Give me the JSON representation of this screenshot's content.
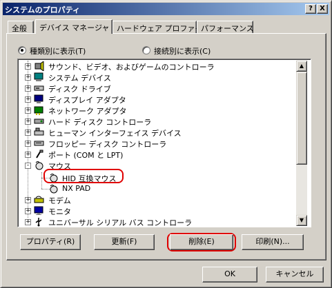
{
  "window": {
    "title": "システムのプロパティ",
    "help_button": "?",
    "close_button": "X"
  },
  "tabs": [
    {
      "label": "全般"
    },
    {
      "label": "デバイス マネージャ"
    },
    {
      "label": "ハードウェア プロファイル"
    },
    {
      "label": "パフォーマンス"
    }
  ],
  "view_options": {
    "by_type": "種類別に表示(T)",
    "by_connection": "接続別に表示(C)",
    "selected": "by_type"
  },
  "tree": [
    {
      "label": "サウンド、ビデオ、およびゲームのコントローラ",
      "icon": "sound-icon",
      "expander": "+"
    },
    {
      "label": "システム デバイス",
      "icon": "system-device-icon",
      "expander": "+"
    },
    {
      "label": "ディスク ドライブ",
      "icon": "disk-drive-icon",
      "expander": "+"
    },
    {
      "label": "ディスプレイ アダプタ",
      "icon": "display-adapter-icon",
      "expander": "+"
    },
    {
      "label": "ネットワーク アダプタ",
      "icon": "network-adapter-icon",
      "expander": "+"
    },
    {
      "label": "ハード ディスク コントローラ",
      "icon": "hard-disk-controller-icon",
      "expander": "+"
    },
    {
      "label": "ヒューマン インターフェイス デバイス",
      "icon": "hid-icon",
      "expander": "+"
    },
    {
      "label": "フロッピー ディスク コントローラ",
      "icon": "floppy-controller-icon",
      "expander": "+"
    },
    {
      "label": "ポート (COM と LPT)",
      "icon": "port-icon",
      "expander": "+"
    },
    {
      "label": "マウス",
      "icon": "mouse-icon",
      "expander": "-"
    },
    {
      "label": "HID 互換マウス",
      "icon": "mouse-icon",
      "child": true
    },
    {
      "label": "NX PAD",
      "icon": "mouse-icon",
      "child": true
    },
    {
      "label": "モデム",
      "icon": "modem-icon",
      "expander": "+"
    },
    {
      "label": "モニタ",
      "icon": "monitor-icon",
      "expander": "+"
    },
    {
      "label": "ユニバーサル シリアル バス コントローラ",
      "icon": "usb-icon",
      "expander": "+"
    }
  ],
  "scrollbar": {
    "up": "▲",
    "down": "▼"
  },
  "buttons": {
    "properties": "プロパティ(R)",
    "refresh": "更新(F)",
    "remove": "削除(E)",
    "print": "印刷(N)...",
    "ok": "OK",
    "cancel": "キャンセル"
  },
  "colors": {
    "highlight": "#e00000",
    "title_bar": "#0a246a"
  }
}
